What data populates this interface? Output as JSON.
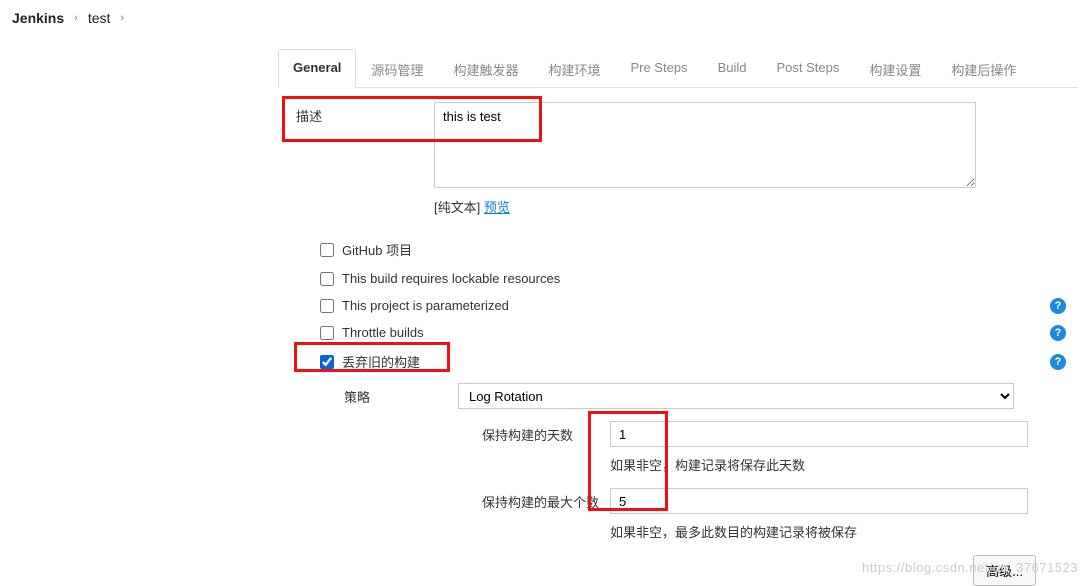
{
  "breadcrumb": {
    "root": "Jenkins",
    "project": "test"
  },
  "tabs": [
    {
      "label": "General",
      "active": true
    },
    {
      "label": "源码管理"
    },
    {
      "label": "构建触发器"
    },
    {
      "label": "构建环境"
    },
    {
      "label": "Pre Steps"
    },
    {
      "label": "Build"
    },
    {
      "label": "Post Steps"
    },
    {
      "label": "构建设置"
    },
    {
      "label": "构建后操作"
    }
  ],
  "description": {
    "label": "描述",
    "value": "this is test",
    "under_prefix": "[纯文本] ",
    "preview": "预览"
  },
  "checks": {
    "github": "GitHub 项目",
    "lockable": "This build requires lockable resources",
    "param": "This project is parameterized",
    "throttle": "Throttle builds",
    "discard": "丢弃旧的构建"
  },
  "strategy": {
    "label": "策略",
    "value": "Log Rotation"
  },
  "retain": {
    "days_label": "保持构建的天数",
    "days_value": "1",
    "days_hint": "如果非空，构建记录将保存此天数",
    "max_label": "保持构建的最大个数",
    "max_value": "5",
    "max_hint": "如果非空，最多此数目的构建记录将被保存"
  },
  "advanced_btn": "高级...",
  "watermark": "https://blog.csdn.net/qq_37671523"
}
